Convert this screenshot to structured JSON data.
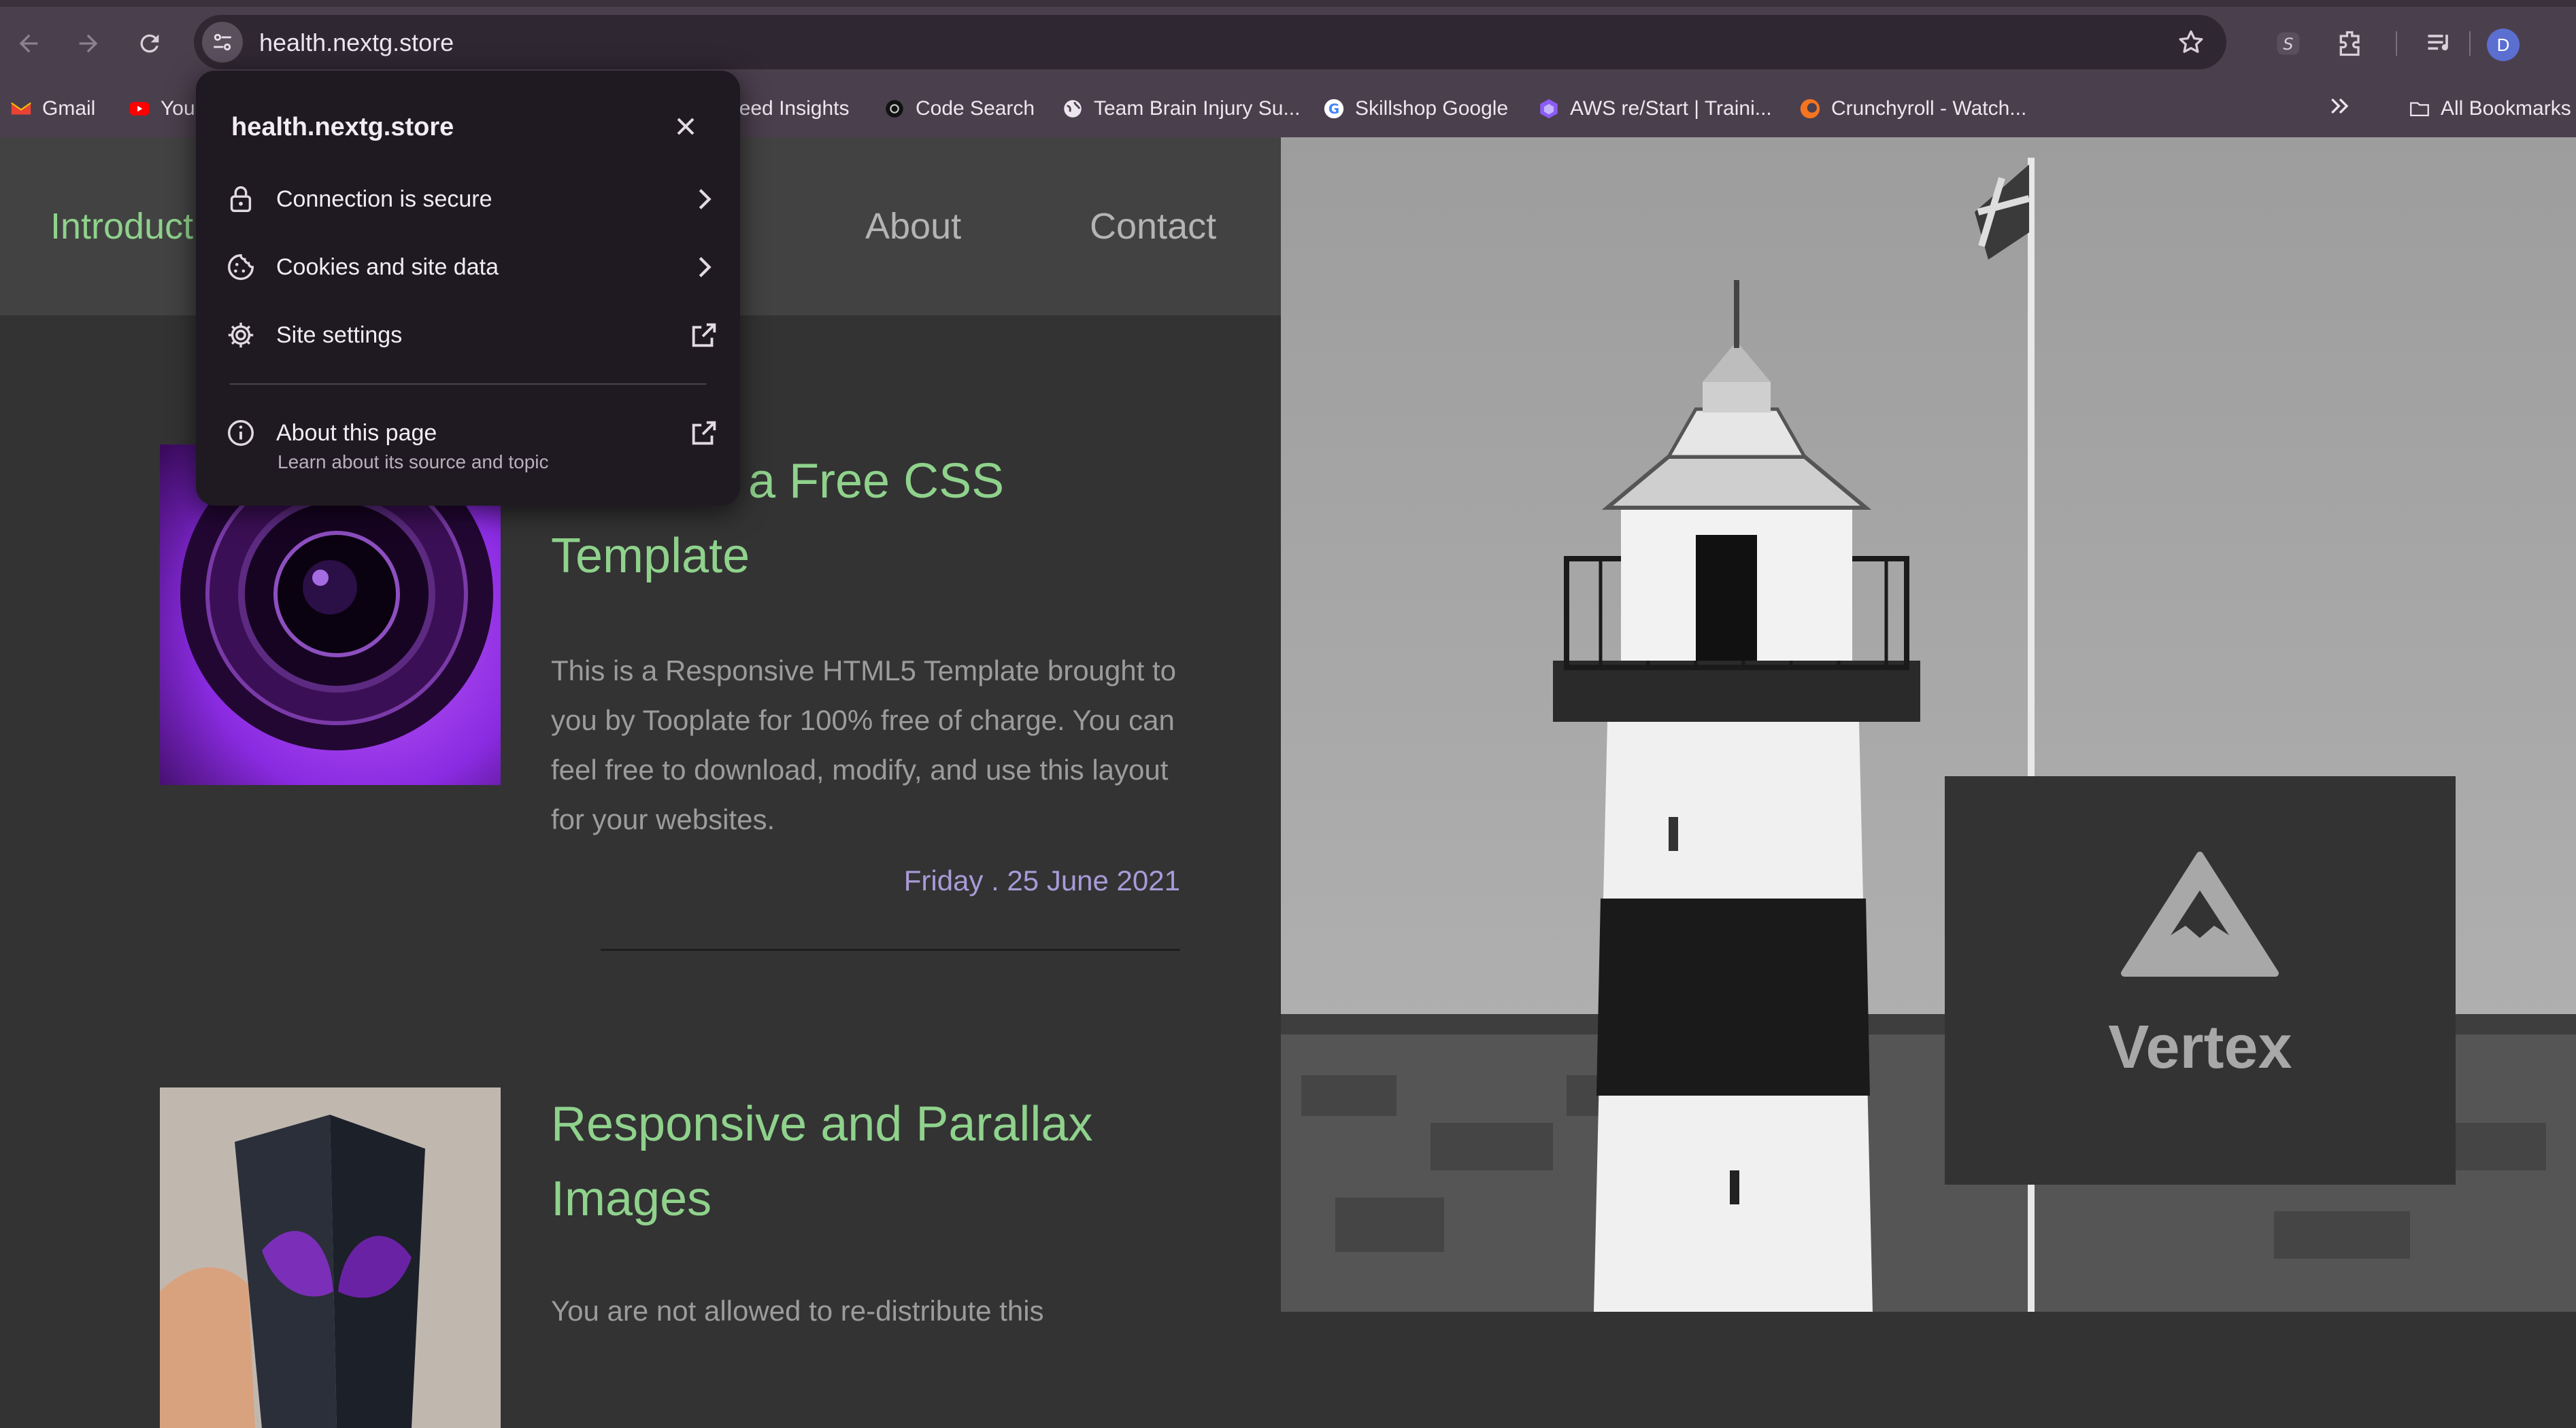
{
  "browser": {
    "url": "health.nextg.store",
    "profile_initial": "D",
    "bookmarks": [
      {
        "label": "Gmail",
        "icon": "gmail-icon"
      },
      {
        "label": "You",
        "icon": "youtube-icon"
      },
      {
        "label": "peed Insights",
        "icon": "pagespeed-icon"
      },
      {
        "label": "Code Search",
        "icon": "code-search-icon"
      },
      {
        "label": "Team Brain Injury Su...",
        "icon": "globe-icon"
      },
      {
        "label": "Skillshop Google",
        "icon": "google-icon"
      },
      {
        "label": "AWS re/Start | Traini...",
        "icon": "aws-icon"
      },
      {
        "label": "Crunchyroll - Watch...",
        "icon": "crunchyroll-icon"
      }
    ],
    "all_bookmarks_label": "All Bookmarks"
  },
  "popup": {
    "title": "health.nextg.store",
    "rows": [
      {
        "label": "Connection is secure",
        "icon": "lock-icon"
      },
      {
        "label": "Cookies and site data",
        "icon": "cookie-icon"
      },
      {
        "label": "Site settings",
        "icon": "gear-icon"
      },
      {
        "label": "About this page",
        "icon": "info-icon"
      }
    ],
    "about_subtitle": "Learn about its source and topic"
  },
  "site": {
    "nav": [
      "Introduct",
      "About",
      "Contact"
    ],
    "posts": [
      {
        "title_line1": "a Free CSS",
        "title_line2": "Template",
        "body": "This is a Responsive HTML5 Template brought to you by Tooplate for 100% free of charge. You can feel free to download, modify, and use this layout for your websites.",
        "date": "Friday . 25 June 2021"
      },
      {
        "title_line1": "Responsive and Parallax",
        "title_line2": "Images",
        "body": "You are not allowed to re-distribute this"
      }
    ],
    "brand": "Vertex"
  },
  "colors": {
    "accent_green": "#8fd28c",
    "date_purple": "#a99bd8",
    "chrome_bg": "#4a3f4d"
  }
}
